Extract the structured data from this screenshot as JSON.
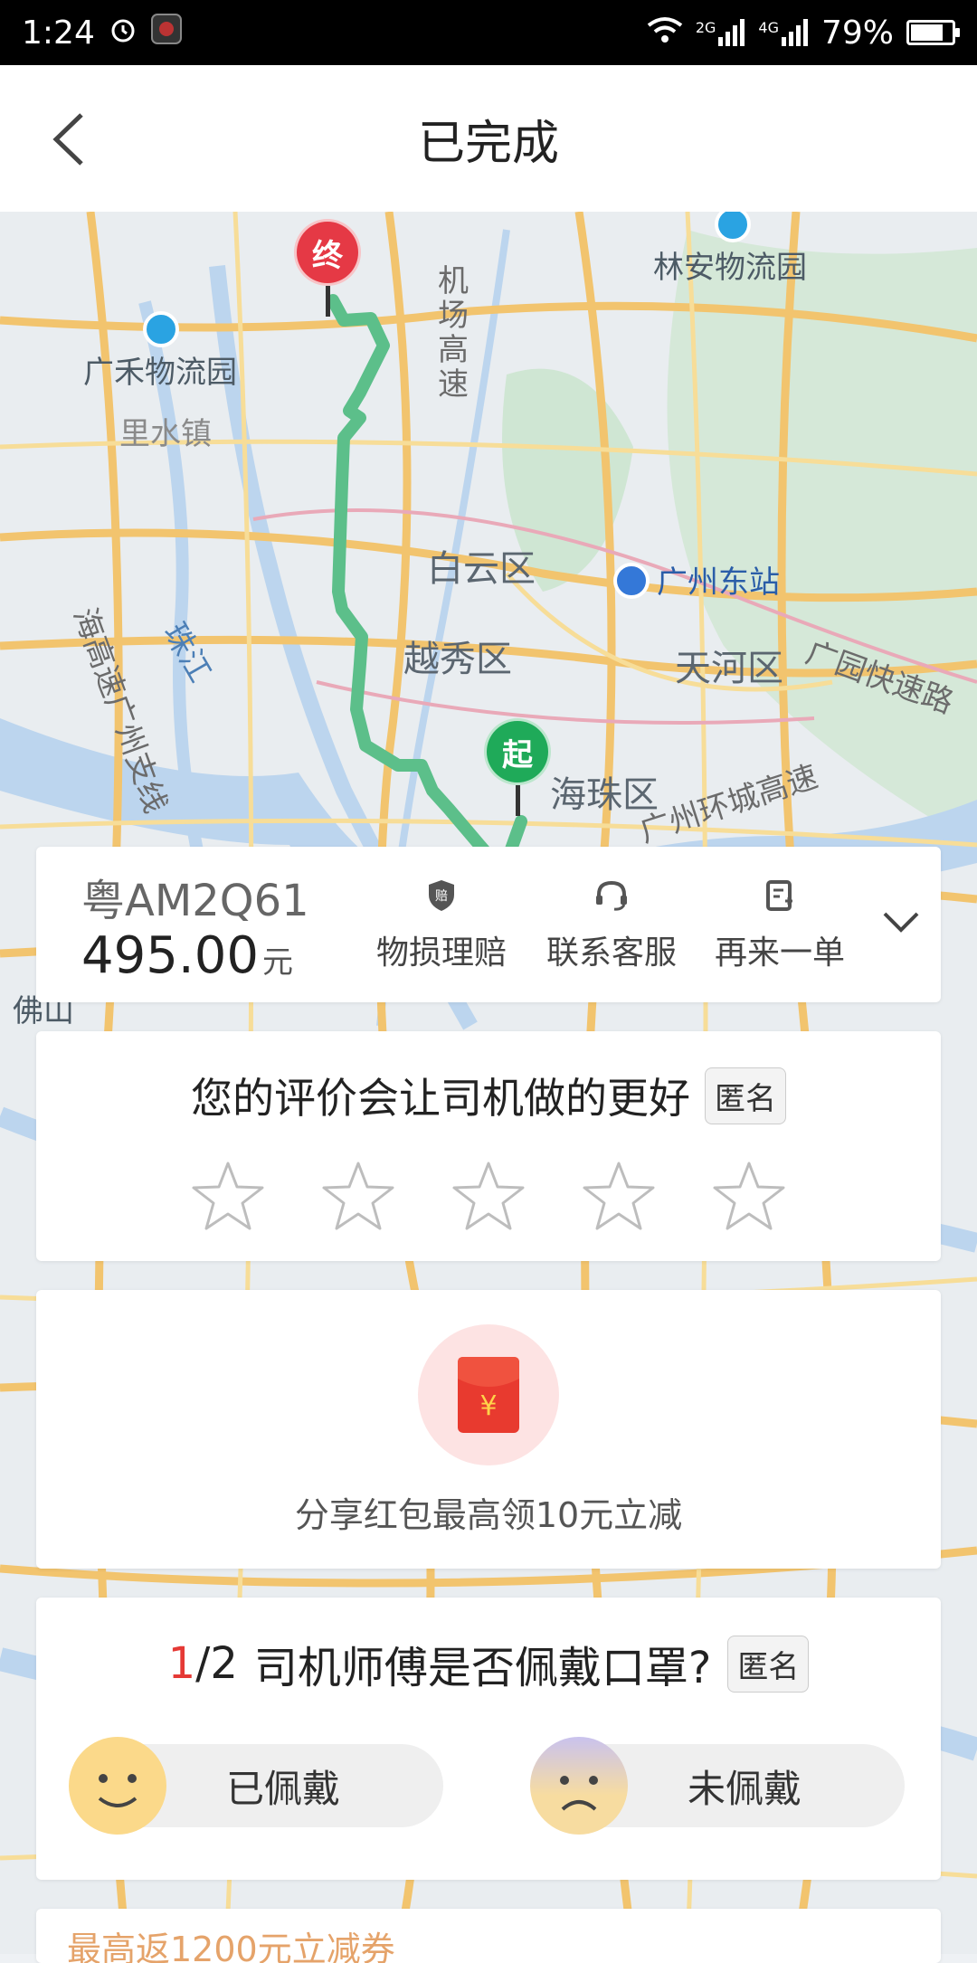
{
  "status_bar": {
    "time": "1:24",
    "alarm_icon": "alarm-clock-icon",
    "app_icon": "app-notification-icon",
    "network_2g": "2G",
    "network_4g": "4G",
    "battery_percent": "79%",
    "battery_level": 0.79
  },
  "header": {
    "title": "已完成",
    "back_icon": "back-arrow-icon"
  },
  "map": {
    "labels": {
      "guanghe": "广禾物流园",
      "linan": "林安物流园",
      "lishui": "里水镇",
      "airport_expwy": "机场高速",
      "baiyun": "白云区",
      "guangzhou_east": "广州东站",
      "yuexiu": "越秀区",
      "tianhe": "天河区",
      "guangyuan": "广园快速路",
      "haizhu": "海珠区",
      "ring_expwy": "广州环城高速",
      "zhujiang": "珠江",
      "foshan": "佛山",
      "left_expwy": "海高速广州支线"
    },
    "start_pin": "起",
    "end_pin": "终",
    "route_color": "#5cbf8a",
    "start_color": "#1faa59",
    "end_color": "#e53945"
  },
  "order": {
    "plate": "粤AM2Q61",
    "price": "495.00",
    "currency": "元",
    "actions": [
      {
        "icon": "compensation-icon",
        "label": "物损理赔"
      },
      {
        "icon": "headset-icon",
        "label": "联系客服"
      },
      {
        "icon": "reorder-icon",
        "label": "再来一单"
      }
    ],
    "expand_icon": "chevron-down-icon"
  },
  "rating": {
    "prompt": "您的评价会让司机做的更好",
    "anonymous_badge": "匿名",
    "stars": 5,
    "selected": 0
  },
  "promo": {
    "icon": "red-packet-icon",
    "symbol": "¥",
    "text": "分享红包最高领10元立减"
  },
  "mask_question": {
    "current": "1",
    "total": "/2",
    "question": "司机师傅是否佩戴口罩?",
    "anonymous_badge": "匿名",
    "options": [
      {
        "face": "happy-face-icon",
        "label": "已佩戴"
      },
      {
        "face": "sad-face-icon",
        "label": "未佩戴"
      }
    ]
  },
  "bottom_promo": {
    "text": "最高返1200元立减券"
  }
}
